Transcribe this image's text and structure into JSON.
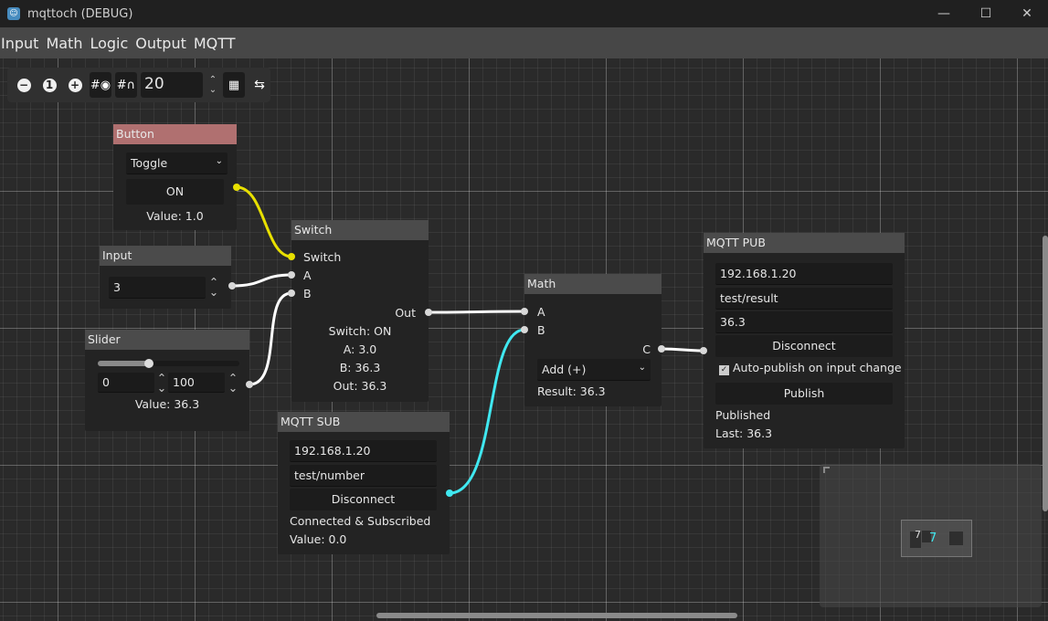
{
  "window": {
    "title": "mqttoch (DEBUG)",
    "minimize": "—",
    "maximize": "☐",
    "close": "✕"
  },
  "menu": [
    "Input",
    "Math",
    "Logic",
    "Output",
    "MQTT"
  ],
  "toolbar": {
    "zoom_out": "−",
    "zoom_reset": "1",
    "zoom_in": "+",
    "snap_value": "20"
  },
  "nodes": {
    "button": {
      "title": "Button",
      "mode": "Toggle",
      "state": "ON",
      "value": "Value: 1.0",
      "title_color": "#b07070"
    },
    "input": {
      "title": "Input",
      "value": "3"
    },
    "slider": {
      "title": "Slider",
      "min": "0",
      "max": "100",
      "value": "Value: 36.3",
      "fraction": 0.363
    },
    "switch": {
      "title": "Switch",
      "ports": [
        "Switch",
        "A",
        "B"
      ],
      "out": "Out",
      "status": "Switch: ON",
      "a": "A: 3.0",
      "b": "B: 36.3",
      "outv": "Out: 36.3"
    },
    "mqtt_sub": {
      "title": "MQTT SUB",
      "host": "192.168.1.20",
      "topic": "test/number",
      "button": "Disconnect",
      "status": "Connected & Subscribed",
      "value": "Value: 0.0"
    },
    "math": {
      "title": "Math",
      "ports": [
        "A",
        "B"
      ],
      "out": "C",
      "op": "Add (+)",
      "result": "Result: 36.3"
    },
    "mqtt_pub": {
      "title": "MQTT PUB",
      "host": "192.168.1.20",
      "topic": "test/result",
      "payload": "36.3",
      "button": "Disconnect",
      "auto": "Auto-publish on input change",
      "auto_checked": true,
      "publish": "Publish",
      "status": "Published",
      "last": "Last: 36.3"
    }
  },
  "wire_colors": {
    "bool": "#e8e000",
    "number": "#ffffff",
    "mqtt": "#40e8f0"
  }
}
